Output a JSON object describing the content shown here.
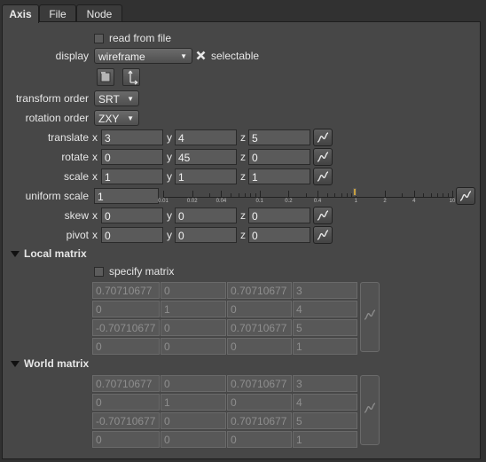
{
  "tabs": [
    "Axis",
    "File",
    "Node"
  ],
  "read_from_file": {
    "label": "read from file",
    "checked": false
  },
  "display": {
    "label": "display",
    "value": "wireframe"
  },
  "selectable": {
    "label": "selectable",
    "checked": true
  },
  "transform_order": {
    "label": "transform order",
    "value": "SRT"
  },
  "rotation_order": {
    "label": "rotation order",
    "value": "ZXY"
  },
  "axis_labels": {
    "x": "x",
    "y": "y",
    "z": "z"
  },
  "translate": {
    "label": "translate",
    "x": "3",
    "y": "4",
    "z": "5"
  },
  "rotate": {
    "label": "rotate",
    "x": "0",
    "y": "45",
    "z": "0"
  },
  "scale": {
    "label": "scale",
    "x": "1",
    "y": "1",
    "z": "1"
  },
  "uniform_scale": {
    "label": "uniform scale",
    "value": "1",
    "slider_value": 1,
    "tick_labels": [
      "0.01",
      "0.02",
      "0.04",
      "0.1",
      "0.2",
      "0.4",
      "1",
      "2",
      "4",
      "10"
    ]
  },
  "skew": {
    "label": "skew",
    "x": "0",
    "y": "0",
    "z": "0"
  },
  "pivot": {
    "label": "pivot",
    "x": "0",
    "y": "0",
    "z": "0"
  },
  "local_matrix": {
    "title": "Local matrix",
    "specify_label": "specify matrix",
    "specify_checked": false,
    "rows": [
      [
        "0.70710677",
        "0",
        "0.70710677",
        "3"
      ],
      [
        "0",
        "1",
        "0",
        "4"
      ],
      [
        "-0.70710677",
        "0",
        "0.70710677",
        "5"
      ],
      [
        "0",
        "0",
        "0",
        "1"
      ]
    ]
  },
  "world_matrix": {
    "title": "World matrix",
    "rows": [
      [
        "0.70710677",
        "0",
        "0.70710677",
        "3"
      ],
      [
        "0",
        "1",
        "0",
        "4"
      ],
      [
        "-0.70710677",
        "0",
        "0.70710677",
        "5"
      ],
      [
        "0",
        "0",
        "0",
        "1"
      ]
    ]
  },
  "colors": {
    "panel_bg": "#474747",
    "field_bg": "#5a5a5a",
    "slider_handle": "#c8a040"
  }
}
